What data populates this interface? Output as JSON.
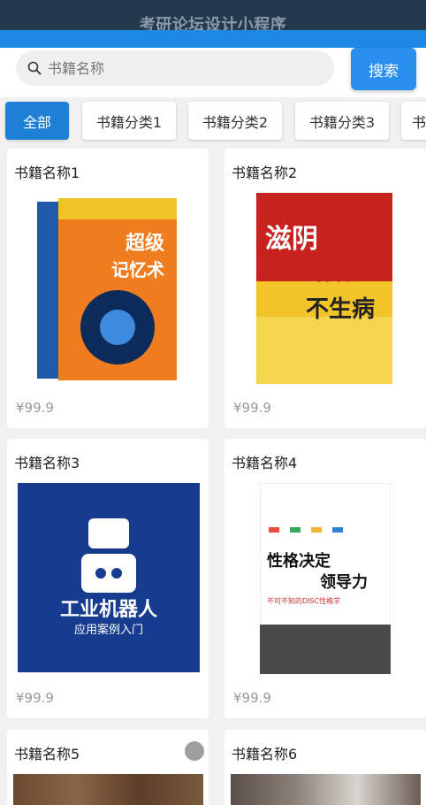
{
  "app": {
    "title": "考研论坛设计小程序"
  },
  "search": {
    "placeholder": "书籍名称",
    "button_label": "搜索"
  },
  "tabs": [
    {
      "label": "全部",
      "active": true
    },
    {
      "label": "书籍分类1",
      "active": false
    },
    {
      "label": "书籍分类2",
      "active": false
    },
    {
      "label": "书籍分类3",
      "active": false
    },
    {
      "label": "书",
      "active": false
    }
  ],
  "books": [
    {
      "name": "书籍名称1",
      "price": "¥99.9",
      "cover_text": [
        "超级",
        "记忆术"
      ]
    },
    {
      "name": "书籍名称2",
      "price": "¥99.9",
      "cover_text": [
        "滋阴",
        "补阳",
        "不生病"
      ]
    },
    {
      "name": "书籍名称3",
      "price": "¥99.9",
      "cover_text": [
        "工业机器人",
        "应用案例入门"
      ]
    },
    {
      "name": "书籍名称4",
      "price": "¥99.9",
      "cover_text": [
        "性格决定",
        "领导力",
        "不可不知的DISC性格学"
      ]
    },
    {
      "name": "书籍名称5",
      "price": ""
    },
    {
      "name": "书籍名称6",
      "price": ""
    }
  ],
  "colors": {
    "primary": "#1e7fd7",
    "topbar": "#23394d",
    "bluebar": "#1e88e5"
  }
}
